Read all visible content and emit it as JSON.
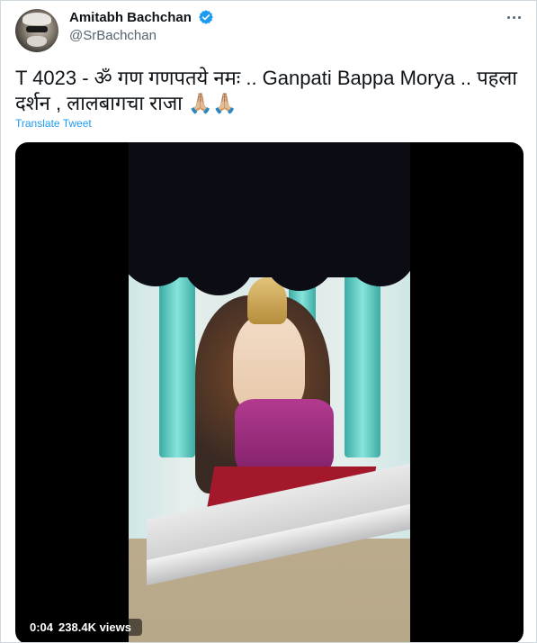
{
  "tweet": {
    "author_name": "Amitabh Bachchan",
    "handle": "@SrBachchan",
    "text": "T 4023 - ॐ गण गणपतये नमः .. Ganpati Bappa Morya .. पहला दर्शन , लालबागचा राजा 🙏🏼🙏🏼",
    "translate_label": "Translate Tweet"
  },
  "video": {
    "time": "0:04",
    "views": "238.4K views"
  },
  "icons": {
    "verified": "verified-badge-icon",
    "more": "more-options-icon"
  },
  "colors": {
    "link": "#1d9bf0",
    "verified": "#1d9bf0",
    "text_primary": "#0f1419",
    "text_secondary": "#536471"
  }
}
